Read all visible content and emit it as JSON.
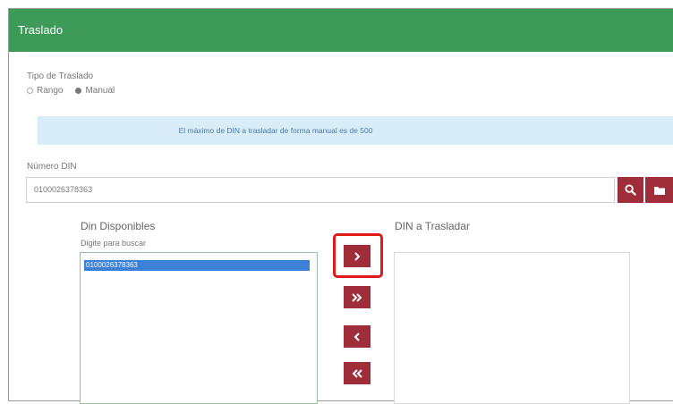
{
  "header": {
    "title": "Traslado"
  },
  "tipo": {
    "label": "Tipo de Traslado",
    "options": [
      {
        "label": "Rango",
        "checked": false
      },
      {
        "label": "Manual",
        "checked": true
      }
    ]
  },
  "alert": {
    "text": "El máximo de DIN a trasladar de forma manual es de 500"
  },
  "numero": {
    "label": "Número DIN",
    "value": "0100026378363"
  },
  "disponibles": {
    "title": "Din Disponibles",
    "search_hint": "Digite para buscar",
    "items": [
      "0100026378363"
    ]
  },
  "trasladar": {
    "title": "DIN a Trasladar"
  },
  "icons": {
    "search": "search-icon",
    "folder": "folder-icon",
    "move_one_right": "chevron-right-icon",
    "move_all_right": "double-chevron-right-icon",
    "move_one_left": "chevron-left-icon",
    "move_all_left": "double-chevron-left-icon"
  },
  "colors": {
    "header": "#3d9a58",
    "button": "#a02d3a",
    "alert_bg": "#d8edf8",
    "selected": "#3b81d8",
    "highlight": "#e01919"
  }
}
